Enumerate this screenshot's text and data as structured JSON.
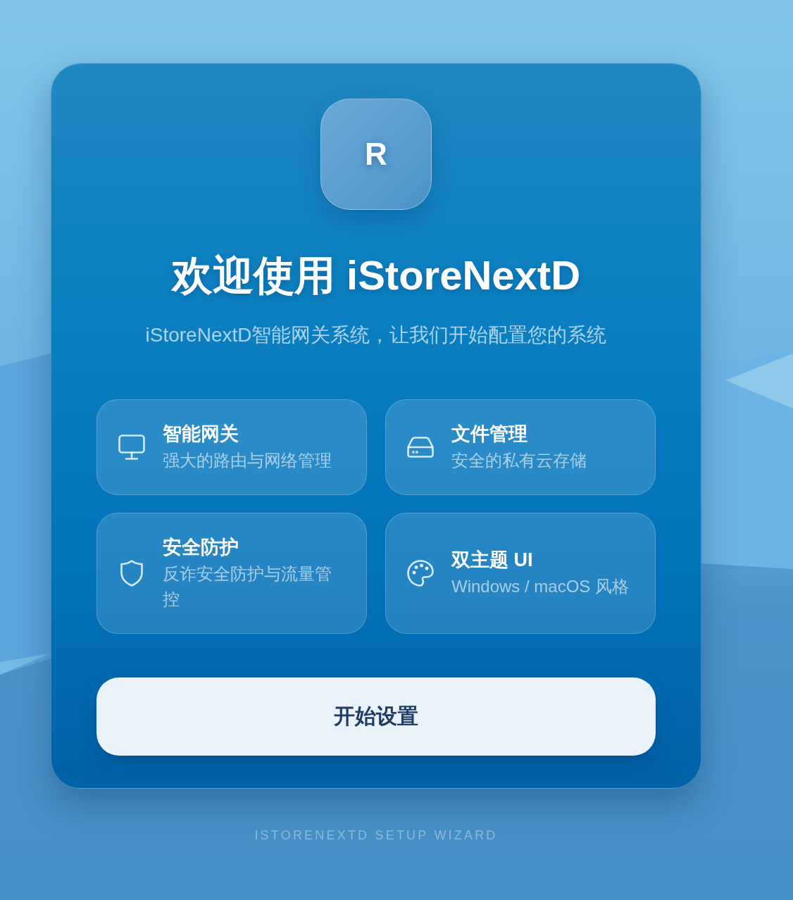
{
  "logo": {
    "letter": "R"
  },
  "title": "欢迎使用 iStoreNextD",
  "subtitle": "iStoreNextD智能网关系统，让我们开始配置您的系统",
  "features": [
    {
      "kind": "monitor",
      "title": "智能网关",
      "description": "强大的路由与网络管理"
    },
    {
      "kind": "drive",
      "title": "文件管理",
      "description": "安全的私有云存储"
    },
    {
      "kind": "shield",
      "title": "安全防护",
      "description": "反诈安全防护与流量管控"
    },
    {
      "kind": "palette",
      "title": "双主题 UI",
      "description": "Windows / macOS 风格"
    }
  ],
  "start_button": {
    "label": "开始设置"
  },
  "footer": "ISTORENEXTD SETUP WIZARD"
}
